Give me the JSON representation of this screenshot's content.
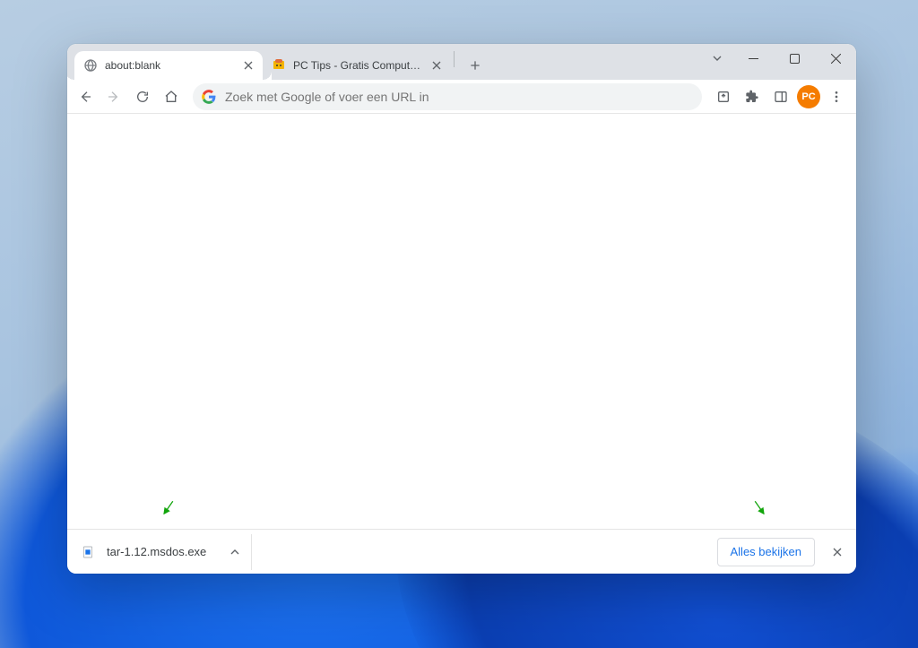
{
  "tabs": [
    {
      "title": "about:blank",
      "favicon": "globe-icon",
      "active": true
    },
    {
      "title": "PC Tips - Gratis Computer Tips...",
      "favicon": "pctips-icon",
      "active": false
    }
  ],
  "omnibox": {
    "placeholder": "Zoek met Google of voer een URL in"
  },
  "profile": {
    "initials": "PC"
  },
  "download": {
    "filename": "tar-1.12.msdos.exe"
  },
  "download_bar": {
    "show_all_label": "Alles bekijken"
  },
  "colors": {
    "accent_blue": "#1a73e8",
    "tabstrip": "#dee1e6",
    "arrow_green": "#11a50b"
  }
}
